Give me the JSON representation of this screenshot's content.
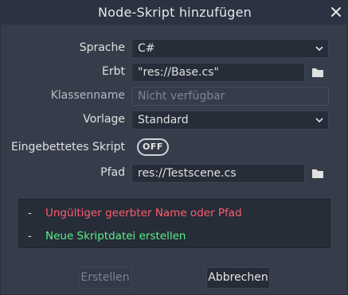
{
  "dialog": {
    "title": "Node-Skript hinzufügen"
  },
  "form": {
    "language": {
      "label": "Sprache",
      "value": "C#"
    },
    "inherits": {
      "label": "Erbt",
      "value": "\"res://Base.cs\""
    },
    "class_name": {
      "label": "Klassenname",
      "placeholder": "Nicht verfügbar"
    },
    "template": {
      "label": "Vorlage",
      "value": "Standard"
    },
    "builtin": {
      "label": "Eingebettetes Skript",
      "toggle_text": "OFF"
    },
    "path": {
      "label": "Pfad",
      "value": "res://Testscene.cs"
    }
  },
  "messages": [
    {
      "bullet": "-",
      "text": "Ungültiger geerbter Name oder Pfad",
      "kind": "error"
    },
    {
      "bullet": "-",
      "text": "Neue Skriptdatei erstellen",
      "kind": "ok"
    }
  ],
  "buttons": {
    "create": "Erstellen",
    "cancel": "Abbrechen"
  },
  "colors": {
    "error": "#ff5d6d",
    "ok": "#5cf08a",
    "background": "#363d4a"
  },
  "icons": {
    "close": "close-icon",
    "dropdown": "chevron-down-icon",
    "browse": "folder-icon"
  }
}
